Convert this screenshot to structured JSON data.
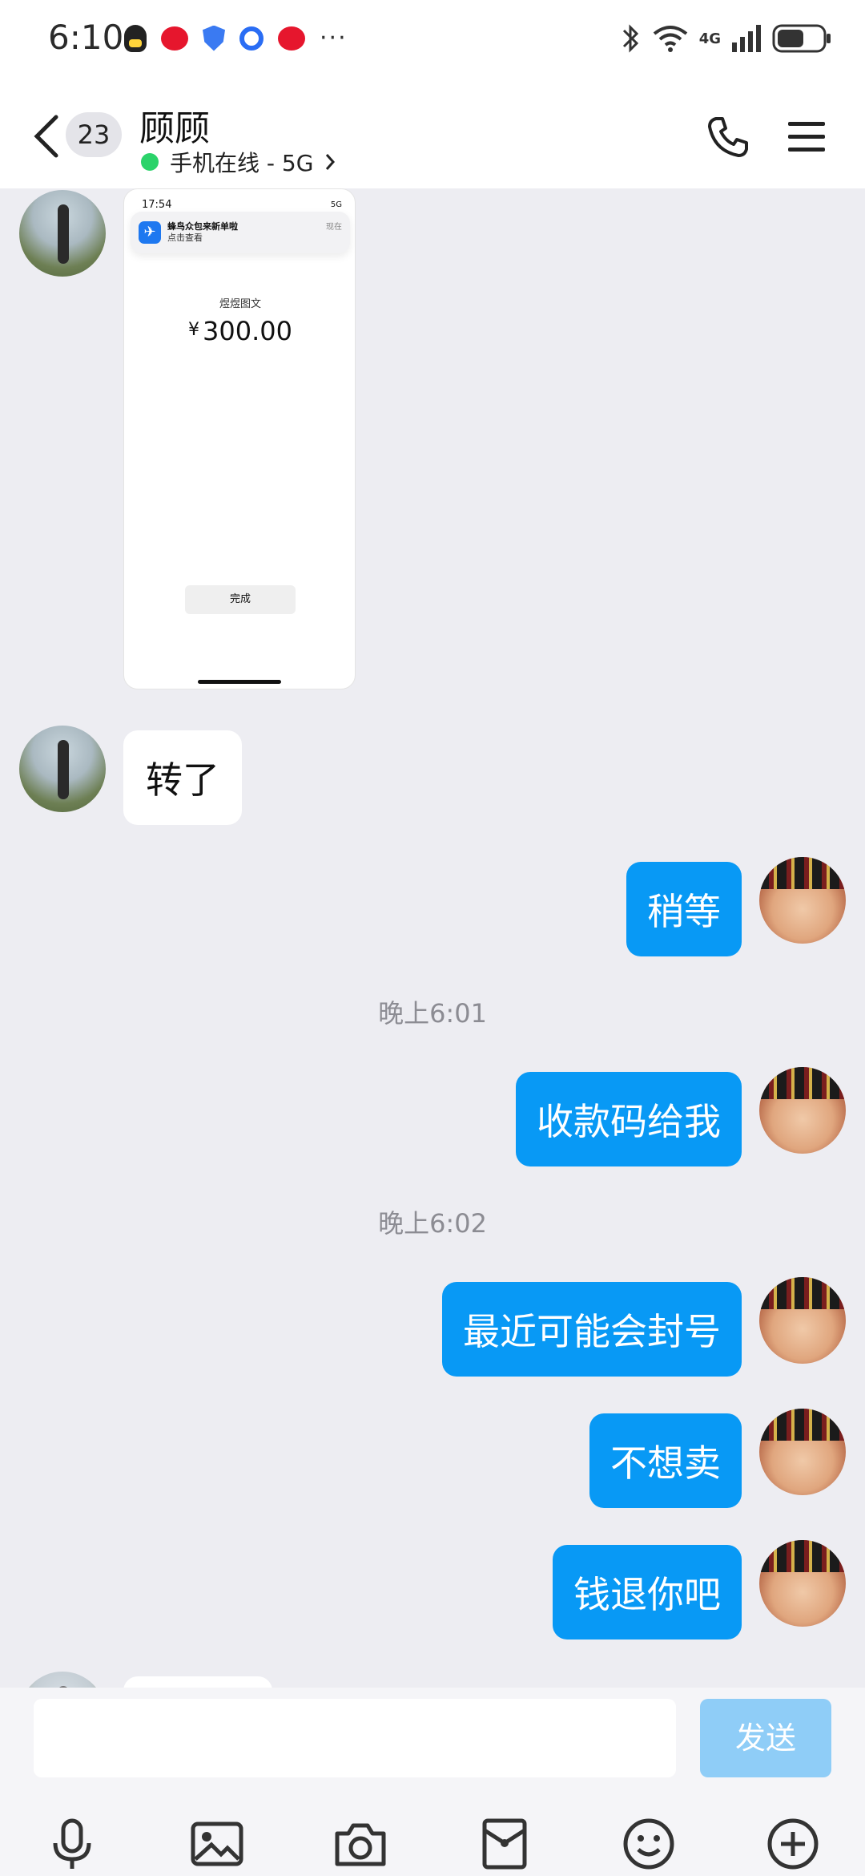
{
  "status_bar": {
    "time": "6:10",
    "network": "4G"
  },
  "header": {
    "unread_count": "23",
    "contact_name": "顾顾",
    "presence": "手机在线 - 5G"
  },
  "screenshot_message": {
    "status_time": "17:54",
    "status_right": "5G",
    "banner_title": "蜂鸟众包来新单啦",
    "banner_subtitle": "点击查看",
    "banner_time": "现在",
    "payee": "煜煜图文",
    "currency": "¥",
    "amount": "300.00",
    "done_label": "完成"
  },
  "messages": [
    {
      "side": "left",
      "text": "转了"
    },
    {
      "side": "right",
      "text": "稍等"
    },
    {
      "side": "time",
      "text": "晚上6:01"
    },
    {
      "side": "right",
      "text": "收款码给我"
    },
    {
      "side": "time",
      "text": "晚上6:02"
    },
    {
      "side": "right",
      "text": "最近可能会封号"
    },
    {
      "side": "right",
      "text": "不想卖"
    },
    {
      "side": "right",
      "text": "钱退你吧"
    }
  ],
  "composer": {
    "input_value": "",
    "send_label": "发送"
  },
  "toolbar": [
    "microphone-icon",
    "image-icon",
    "camera-icon",
    "red-packet-icon",
    "emoji-icon",
    "plus-icon"
  ]
}
